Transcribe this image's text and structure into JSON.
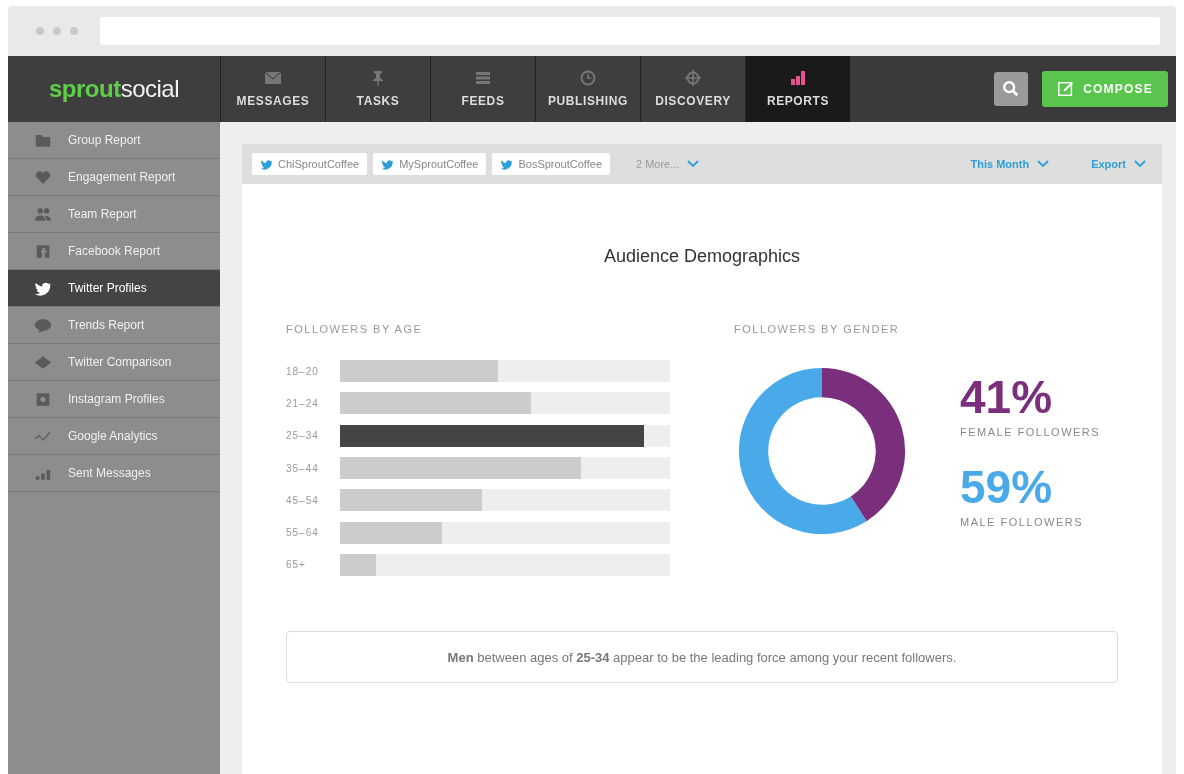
{
  "brand": {
    "part_1": "sprout",
    "part_2": "social"
  },
  "nav": [
    {
      "label": "MESSAGES",
      "kind": "envelope",
      "selected": false
    },
    {
      "label": "TASKS",
      "kind": "pin",
      "selected": false
    },
    {
      "label": "FEEDS",
      "kind": "lines",
      "selected": false
    },
    {
      "label": "PUBLISHING",
      "kind": "clock",
      "selected": false
    },
    {
      "label": "DISCOVERY",
      "kind": "target",
      "selected": false
    },
    {
      "label": "REPORTS",
      "kind": "bars",
      "selected": true
    }
  ],
  "compose_button": "COMPOSE",
  "sidebar": {
    "items": [
      {
        "label": "Group Report",
        "kind": "folder",
        "selected": false
      },
      {
        "label": "Engagement Report",
        "kind": "heart",
        "selected": false
      },
      {
        "label": "Team Report",
        "kind": "people",
        "selected": false
      },
      {
        "label": "Facebook Report",
        "kind": "facebook",
        "selected": false
      },
      {
        "label": "Twitter Profiles",
        "kind": "bird",
        "selected": true
      },
      {
        "label": "Trends Report",
        "kind": "bubble",
        "selected": false
      },
      {
        "label": "Twitter Comparison",
        "kind": "diamond",
        "selected": false
      },
      {
        "label": "Instagram Profiles",
        "kind": "camera",
        "selected": false
      },
      {
        "label": "Google Analytics",
        "kind": "trend",
        "selected": false
      },
      {
        "label": "Sent Messages",
        "kind": "bars",
        "selected": false
      }
    ]
  },
  "filters": {
    "profiles": [
      "ChiSproutCoffee",
      "MySproutCoffee",
      "BosSproutCoffee"
    ],
    "more": "2 More...",
    "period": "This Month",
    "export": "Export"
  },
  "title": "Audience Demographics",
  "age": {
    "heading": "FOLLOWERS BY AGE",
    "rows": [
      {
        "label": "18–20",
        "level": 0.48,
        "highlighted": false
      },
      {
        "label": "21–24",
        "level": 0.58,
        "highlighted": false
      },
      {
        "label": "25–34",
        "level": 0.92,
        "highlighted": true
      },
      {
        "label": "35–44",
        "level": 0.73,
        "highlighted": false
      },
      {
        "label": "45–54",
        "level": 0.43,
        "highlighted": false
      },
      {
        "label": "55–64",
        "level": 0.31,
        "highlighted": false
      },
      {
        "label": "65+",
        "level": 0.11,
        "highlighted": false
      }
    ]
  },
  "gender": {
    "heading": "FOLLOWERS BY GENDER",
    "segments": [
      {
        "value": "41%",
        "label": "FEMALE FOLLOWERS",
        "color": "#7a2f7c"
      },
      {
        "value": "59%",
        "label": "MALE FOLLOWERS",
        "color": "#4aa9e9"
      }
    ]
  },
  "summary": "**Men** between ages of **25-34** appear to be the leading force among your recent followers."
}
